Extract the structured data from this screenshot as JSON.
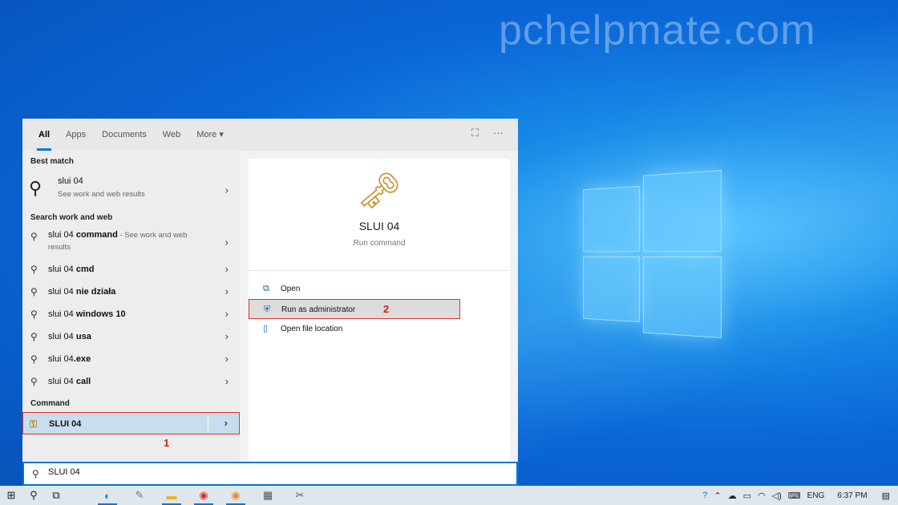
{
  "watermark": "pchelpmate.com",
  "tabs": {
    "items": [
      "All",
      "Apps",
      "Documents",
      "Web",
      "More ▾"
    ]
  },
  "best_match": {
    "section": "Best match",
    "title": "slui 04",
    "subtitle": "See work and web results"
  },
  "search_web": {
    "section": "Search work and web",
    "first": {
      "title_plain": "slui 04 ",
      "title_bold": "command",
      "hint": " - See work and web results"
    },
    "items": [
      {
        "plain": "slui 04 ",
        "bold": "cmd"
      },
      {
        "plain": "slui 04 ",
        "bold": "nie działa"
      },
      {
        "plain": "slui 04 ",
        "bold": "windows 10"
      },
      {
        "plain": "slui 04 ",
        "bold": "usa"
      },
      {
        "plain": "slui 04",
        "bold": ".exe"
      },
      {
        "plain": "slui 04 ",
        "bold": "call"
      }
    ]
  },
  "command": {
    "section": "Command",
    "label": "SLUI 04",
    "badge": "1"
  },
  "preview": {
    "title": "SLUI 04",
    "subtitle": "Run command",
    "actions": [
      {
        "label": "Open",
        "icon": "open-icon"
      },
      {
        "label": "Run as administrator",
        "icon": "shield-icon"
      },
      {
        "label": "Open file location",
        "icon": "folder-icon"
      }
    ],
    "badge": "2"
  },
  "search_box": {
    "value": "SLUI 04"
  },
  "taskbar": {
    "lang": "ENG",
    "time": "6:37 PM"
  },
  "colors": {
    "accent": "#0078d7",
    "highlight_border": "#e03030",
    "badge": "#d32020"
  }
}
